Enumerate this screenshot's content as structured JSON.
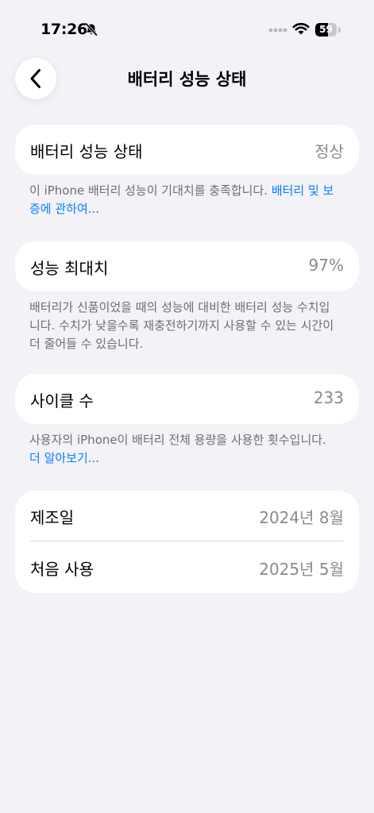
{
  "status_bar": {
    "time": "17:26",
    "battery_level": "59",
    "battery_fraction": 0.59
  },
  "nav": {
    "title": "배터리 성능 상태"
  },
  "health_section": {
    "label": "배터리 성능 상태",
    "value": "정상",
    "footnote_text": "이 iPhone 배터리 성능이 기대치를 충족합니다. ",
    "footnote_link": "배터리 및 보증에 관하여..."
  },
  "capacity_section": {
    "label": "성능 최대치",
    "value": "97%",
    "footnote_text": "배터리가 신품이었을 때의 성능에 대비한 배터리 성능 수치입니다. 수치가 낮을수록 재충전하기까지 사용할 수 있는 시간이 더 줄어들 수 있습니다."
  },
  "cycle_section": {
    "label": "사이클 수",
    "value": "233",
    "footnote_text": "사용자의 iPhone이 배터리 전체 용량을 사용한 횟수입니다. ",
    "footnote_link": "더 알아보기..."
  },
  "dates_section": {
    "manufacture_label": "제조일",
    "manufacture_value": "2024년 8월",
    "first_use_label": "처음 사용",
    "first_use_value": "2025년 5월"
  },
  "icons": {
    "back": "chevron-left-icon",
    "mute": "bell-slash-icon",
    "wifi": "wifi-icon",
    "signal": "signal-dots-icon"
  },
  "colors": {
    "background": "#f2f2f7",
    "card": "#ffffff",
    "secondary_text": "#8a8a8e",
    "footnote_text": "#6d6d72",
    "link": "#0a7cff"
  }
}
